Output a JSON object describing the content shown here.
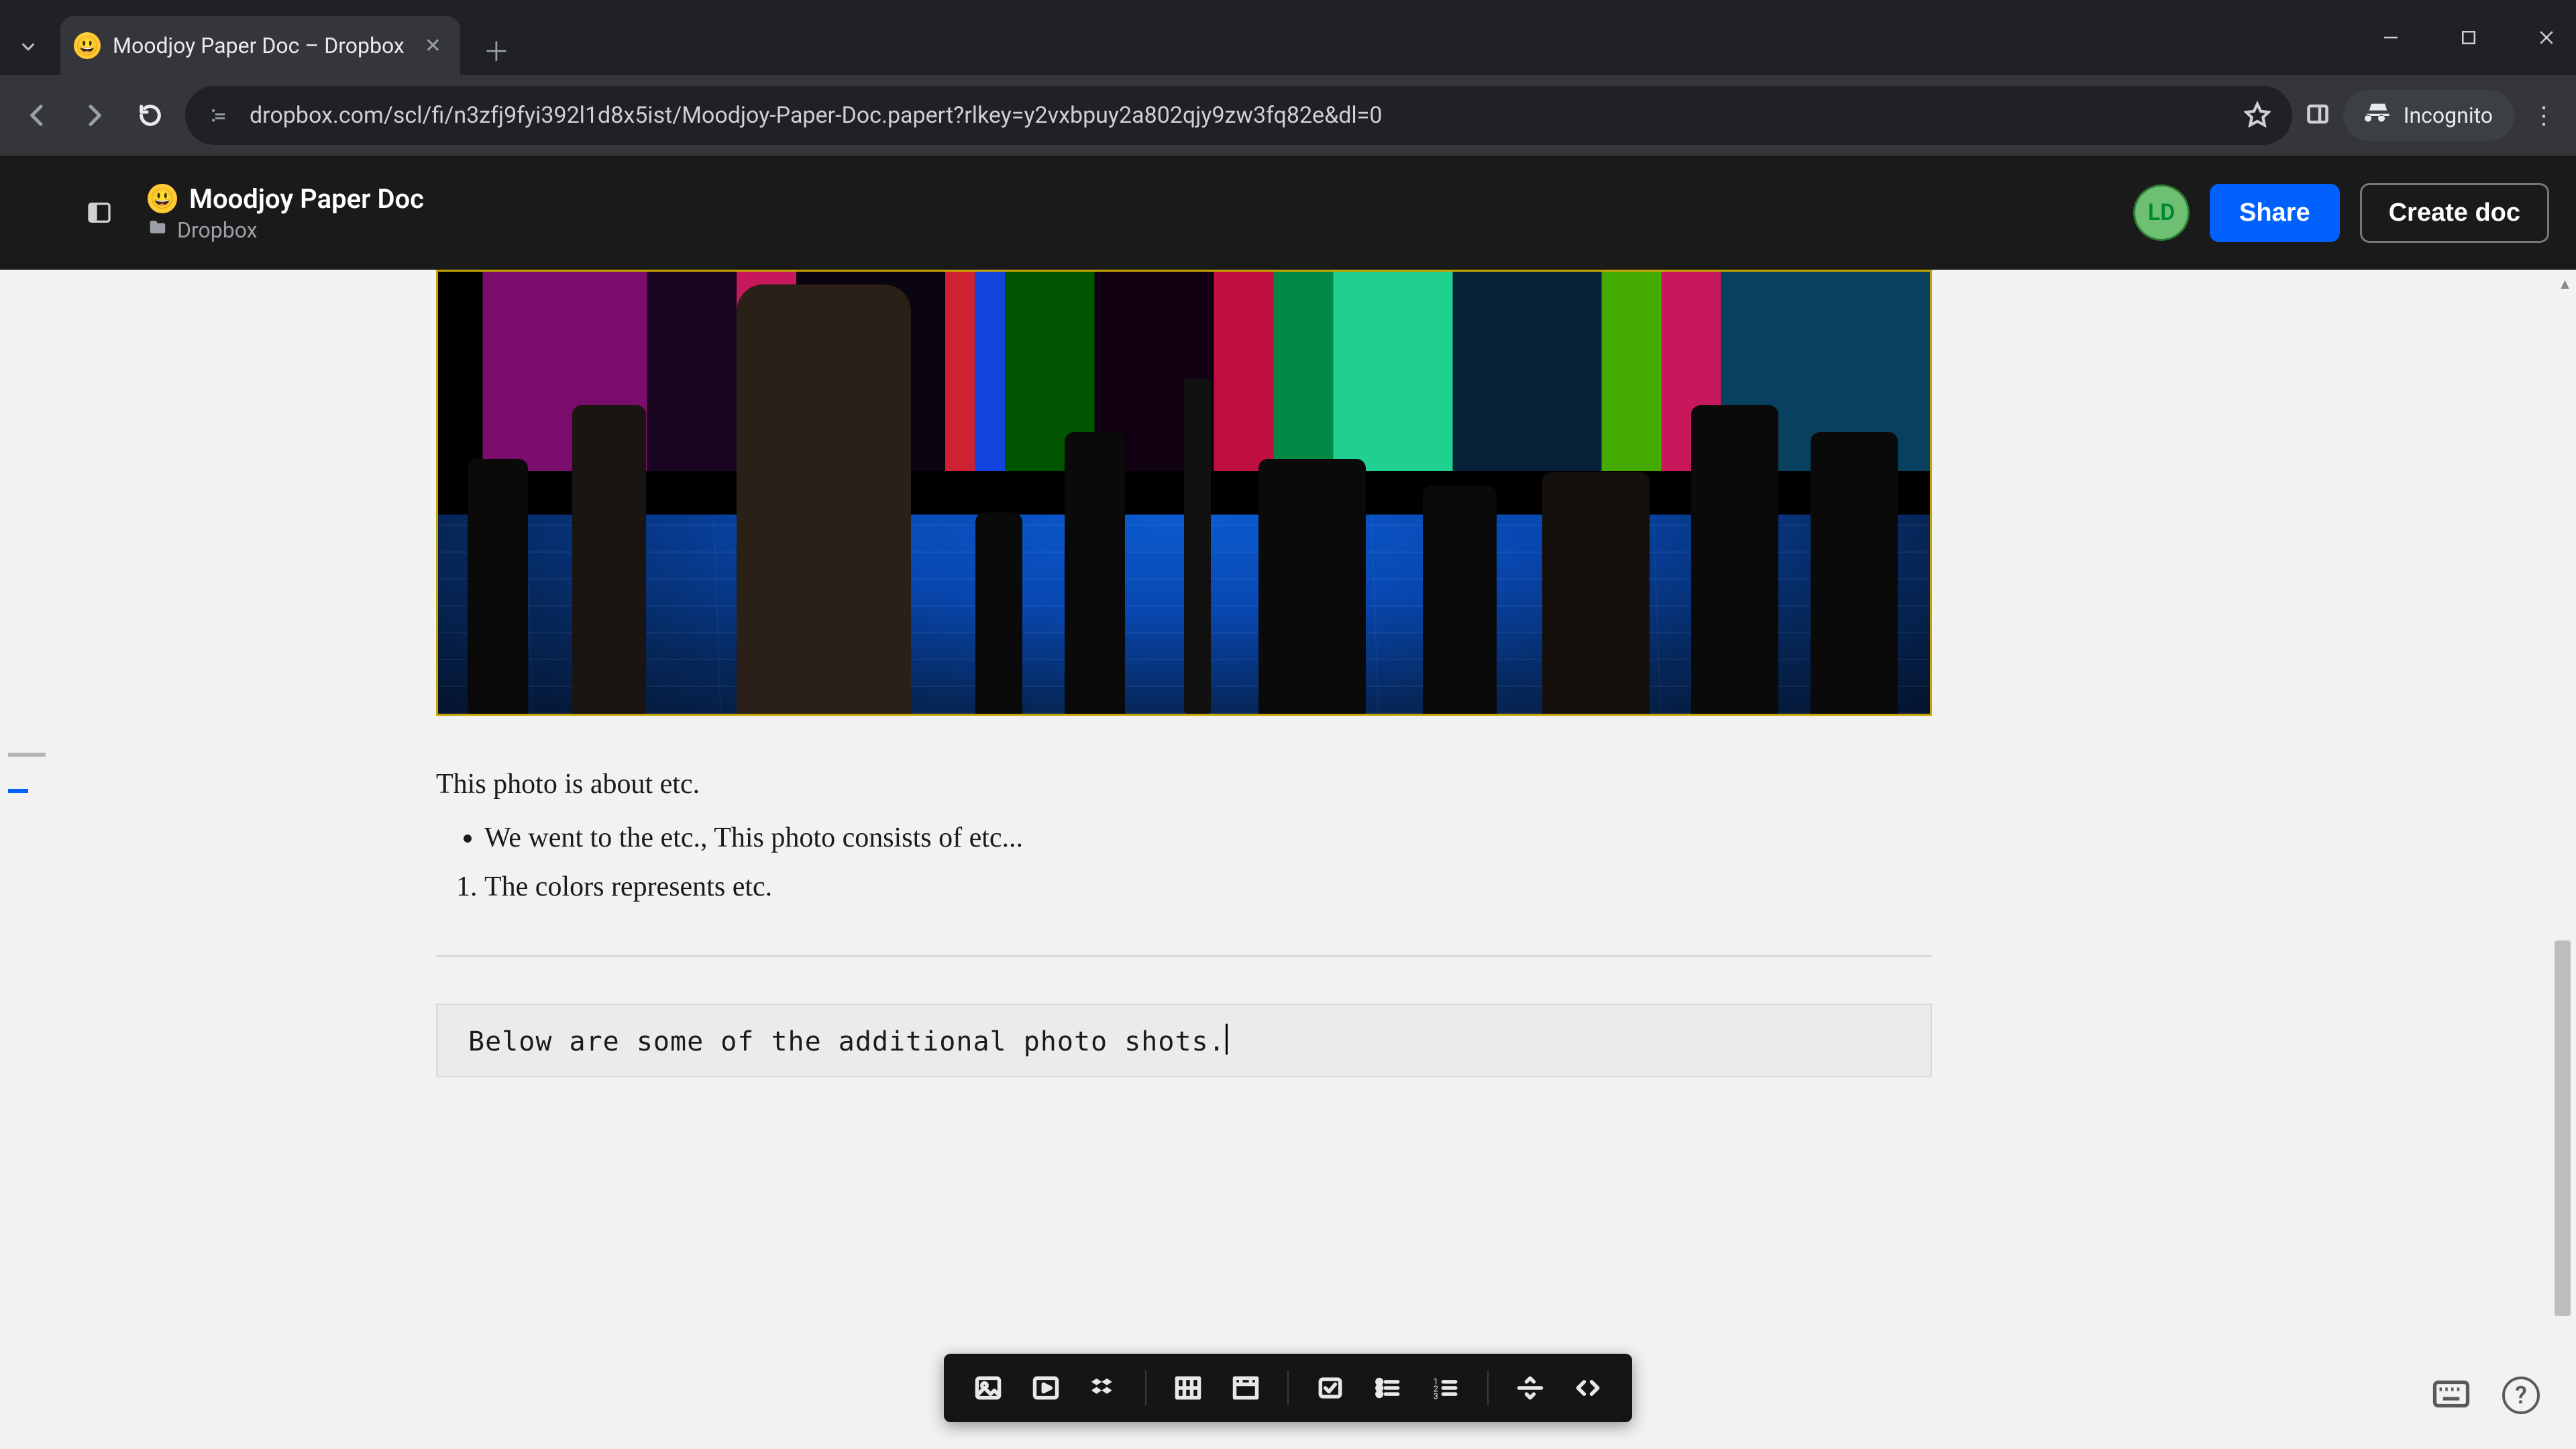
{
  "browser": {
    "tab_title": "Moodjoy Paper Doc – Dropbox",
    "url": "dropbox.com/scl/fi/n3zfj9fyi392l1d8x5ist/Moodjoy-Paper-Doc.papert?rlkey=y2vxbpuy2a802qjy9zw3fq82e&dl=0",
    "incognito_label": "Incognito"
  },
  "header": {
    "doc_title": "Moodjoy Paper Doc",
    "breadcrumb": "Dropbox",
    "avatar_initials": "LD",
    "share_label": "Share",
    "create_label": "Create doc"
  },
  "document": {
    "caption": "This photo is about etc.",
    "bullet_item": "We went to the etc., This photo consists of etc...",
    "numbered_item": "The colors represents etc.",
    "code_text": "Below are some of the additional photo shots."
  },
  "insert_toolbar": {
    "items": [
      "image",
      "video",
      "dropbox",
      "table",
      "timeline",
      "checklist",
      "bulleted-list",
      "numbered-list",
      "divider",
      "code"
    ]
  },
  "colors": {
    "accent": "#0061fe",
    "image_border": "#c7a500"
  }
}
